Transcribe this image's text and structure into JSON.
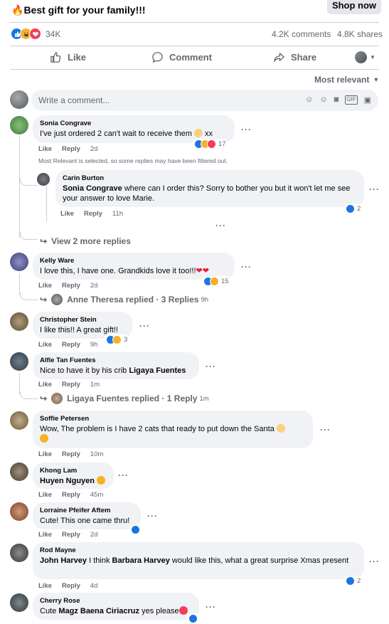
{
  "post": {
    "title": "Best gift for your family!!!",
    "shop_label": "Shop now",
    "reaction_count": "34K",
    "comments_count": "4.2K comments",
    "shares_count": "4.8K shares"
  },
  "actions": {
    "like": "Like",
    "comment": "Comment",
    "share": "Share"
  },
  "sort_label": "Most relevant",
  "composer": {
    "placeholder": "Write a comment..."
  },
  "notice": "Most Relevant is selected, so some replies may have been filtered out.",
  "comments": [
    {
      "name": "Sonia Congrave",
      "text": "I've just ordered 2 can't wait to receive them",
      "suffix": "xx",
      "like": "Like",
      "reply": "Reply",
      "time": "2d",
      "reactions": "17"
    },
    {
      "name": "Carin Burton",
      "tag": "Sonia Congrave",
      "text": "where can I order this? Sorry to bother you but it won't let me see your answer to love Marie.",
      "like": "Like",
      "reply": "Reply",
      "time": "11h",
      "reactions": "2"
    },
    {
      "name": "Kelly Ware",
      "text": "I love this, I have one. Grandkids love it too!!!",
      "like": "Like",
      "reply": "Reply",
      "time": "2d",
      "reactions": "15"
    },
    {
      "name": "Christopher Stein",
      "text": "I like this!! A great gift!!",
      "like": "Like",
      "reply": "Reply",
      "time": "9h",
      "reactions": "3"
    },
    {
      "name": "Alfie Tan Fuentes",
      "text": "Nice to have it by his crib",
      "tag": "Ligaya Fuentes",
      "like": "Like",
      "reply": "Reply",
      "time": "1m"
    },
    {
      "name": "Soffie Petersen",
      "text": "Wow, The problem is I have 2 cats that ready to put down the Santa",
      "like": "Like",
      "reply": "Reply",
      "time": "10m"
    },
    {
      "name": "Khong Lam",
      "tag": "Huyen Nguyen",
      "like": "Like",
      "reply": "Reply",
      "time": "45m"
    },
    {
      "name": "Lorraine Pfeifer Aftem",
      "text": "Cute! This one came thru!",
      "like": "Like",
      "reply": "Reply",
      "time": "2d"
    },
    {
      "name": "Rod Mayne",
      "tag": "John Harvey",
      "text1": "I think",
      "tag2": "Barbara Harvey",
      "text2": "would like this, what a great surprise Xmas present",
      "like": "Like",
      "reply": "Reply",
      "time": "4d",
      "reactions": "2"
    },
    {
      "name": "Cherry Rose",
      "text": "Cute",
      "tag": "Magz Baena Ciriacruz",
      "text2": "yes please"
    }
  ],
  "view_more": "View 2 more replies",
  "thread_replies": [
    {
      "label": "Anne Theresa replied · 3 Replies",
      "time": "9h"
    },
    {
      "label": "Ligaya Fuentes replied · 1 Reply",
      "time": "1m"
    }
  ]
}
